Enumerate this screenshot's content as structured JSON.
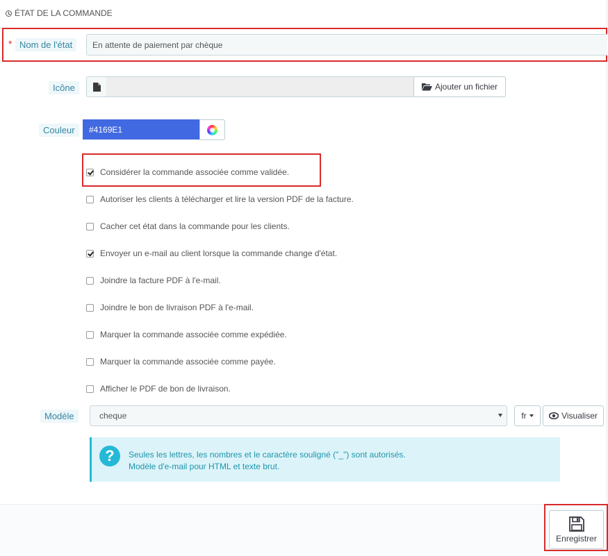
{
  "panel": {
    "title": "ÉTAT DE LA COMMANDE"
  },
  "form": {
    "name": {
      "label": "Nom de l'état",
      "required_mark": "*",
      "value": "En attente de paiement par chèque"
    },
    "icon": {
      "label": "Icône",
      "button_label": "Ajouter un fichier"
    },
    "color": {
      "label": "Couleur",
      "value": "#4169E1"
    },
    "checkboxes": [
      {
        "label": "Considérer la commande associée comme validée.",
        "checked": true
      },
      {
        "label": "Autoriser les clients à télécharger et lire la version PDF de la facture.",
        "checked": false
      },
      {
        "label": "Cacher cet état dans la commande pour les clients.",
        "checked": false
      },
      {
        "label": "Envoyer un e-mail au client lorsque la commande change d'état.",
        "checked": true
      },
      {
        "label": "Joindre la facture PDF à l'e-mail.",
        "checked": false
      },
      {
        "label": "Joindre le bon de livraison PDF à l'e-mail.",
        "checked": false
      },
      {
        "label": "Marquer la commande associée comme expédiée.",
        "checked": false
      },
      {
        "label": "Marquer la commande associée comme payée.",
        "checked": false
      },
      {
        "label": "Afficher le PDF de bon de livraison.",
        "checked": false
      }
    ],
    "template": {
      "label": "Modèle",
      "value": "cheque",
      "lang": "fr",
      "preview_label": "Visualiser"
    },
    "help": {
      "line1": "Seules les lettres, les nombres et le caractère souligné (\"_\") sont autorisés.",
      "line2": "Modèle d'e-mail pour HTML et texte brut."
    }
  },
  "footer": {
    "save_label": "Enregistrer"
  },
  "colors": {
    "accent": "#25b9d7",
    "label_text": "#3585a0",
    "highlight": "#d92a2a",
    "swatch": "#4169e1"
  }
}
